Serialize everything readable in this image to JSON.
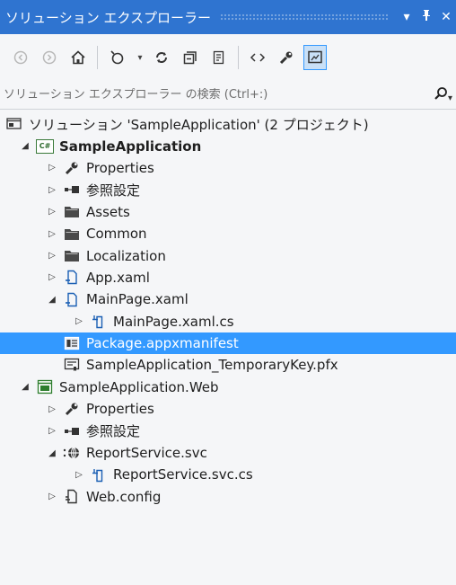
{
  "window": {
    "title": "ソリューション エクスプローラー",
    "dropdown_icon": "dropdown-arrow-icon",
    "pin_icon": "pin-icon",
    "close_icon": "close-icon",
    "close_glyph": "✕"
  },
  "toolbar": {
    "buttons": [
      "back-icon",
      "forward-icon",
      "home-icon",
      "pending-changes-icon",
      "refresh-icon",
      "collapse-all-icon",
      "show-all-files-icon",
      "view-code-icon",
      "properties-icon",
      "preview-icon"
    ]
  },
  "search": {
    "placeholder": "ソリューション エクスプローラー の検索 (Ctrl+:)",
    "icon": "search-icon"
  },
  "tree": [
    {
      "label": "ソリューション 'SampleApplication' (2 プロジェクト)",
      "icon": "solution-icon"
    },
    {
      "label": "SampleApplication",
      "icon": "csharp-project-icon"
    },
    {
      "label": "Properties",
      "icon": "wrench-icon"
    },
    {
      "label": "参照設定",
      "icon": "references-icon"
    },
    {
      "label": "Assets",
      "icon": "folder-icon"
    },
    {
      "label": "Common",
      "icon": "folder-icon"
    },
    {
      "label": "Localization",
      "icon": "folder-icon"
    },
    {
      "label": "App.xaml",
      "icon": "xaml-file-icon"
    },
    {
      "label": "MainPage.xaml",
      "icon": "xaml-file-icon"
    },
    {
      "label": "MainPage.xaml.cs",
      "icon": "cs-file-icon"
    },
    {
      "label": "Package.appxmanifest",
      "icon": "manifest-icon"
    },
    {
      "label": "SampleApplication_TemporaryKey.pfx",
      "icon": "certificate-icon"
    },
    {
      "label": "SampleApplication.Web",
      "icon": "web-project-icon"
    },
    {
      "label": "Properties",
      "icon": "wrench-icon"
    },
    {
      "label": "参照設定",
      "icon": "references-icon"
    },
    {
      "label": "ReportService.svc",
      "icon": "service-icon"
    },
    {
      "label": "ReportService.svc.cs",
      "icon": "cs-file-icon"
    },
    {
      "label": "Web.config",
      "icon": "config-file-icon"
    }
  ],
  "selected_item": "Package.appxmanifest",
  "colors": {
    "title_bar": "#2f74d0",
    "selection": "#3399ff",
    "background": "#f5f6f8"
  }
}
